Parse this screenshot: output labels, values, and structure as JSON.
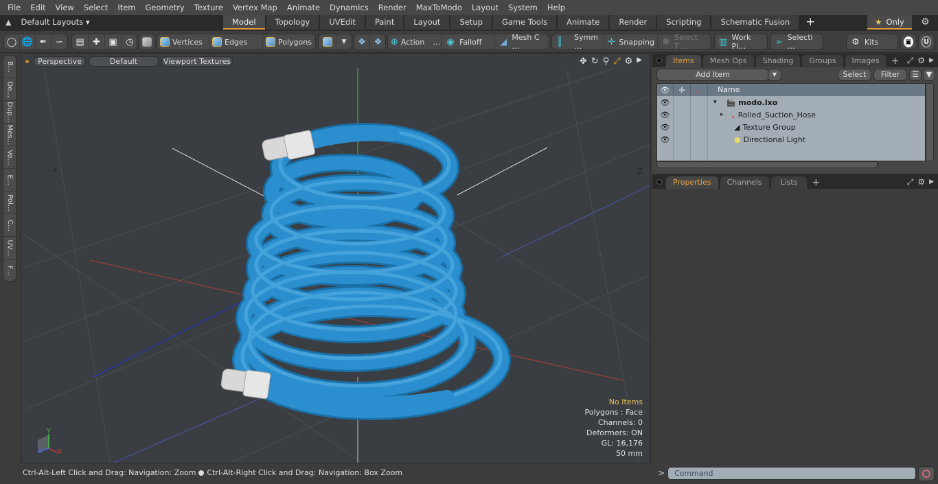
{
  "menu": [
    "File",
    "Edit",
    "View",
    "Select",
    "Item",
    "Geometry",
    "Texture",
    "Vertex Map",
    "Animate",
    "Dynamics",
    "Render",
    "MaxToModo",
    "Layout",
    "System",
    "Help"
  ],
  "layout_bar": {
    "layouts_label": "Default Layouts ▾",
    "tabs": [
      "Model",
      "Topology",
      "UVEdit",
      "Paint",
      "Layout",
      "Setup",
      "Game Tools",
      "Animate",
      "Render",
      "Scripting",
      "Schematic Fusion"
    ],
    "active_tab": "Model",
    "add_tab": "+",
    "only_label": "Only",
    "accent_color": "#e09a3c"
  },
  "toolbar": {
    "vertices": "Vertices",
    "edges": "Edges",
    "polygons": "Polygons",
    "action": "Action",
    "falloff": "Falloff",
    "mesh_c": "Mesh C …",
    "symm": "Symm …",
    "snapping": "Snapping",
    "select_t": "Select T…",
    "work_pl": "Work Pl…",
    "selecti": "Selecti …",
    "kits": "Kits",
    "ellipsis": "…"
  },
  "left_tabs": [
    "B…",
    "De…",
    "Dup…",
    "Mes…",
    "Ve…",
    "E…",
    "Pol…",
    "C…",
    "UV…",
    "F…"
  ],
  "viewport": {
    "view_mode": "Perspective",
    "shading": "Default",
    "textures": "Viewport Textures",
    "axis_labels": {
      "neg_x": "-X",
      "neg_z": "-Z",
      "x": "X",
      "y": "Y",
      "z": "Z"
    },
    "info": {
      "selection": "No Items",
      "polygons": "Polygons : Face",
      "channels": "Channels: 0",
      "deformers": "Deformers: ON",
      "gl": "GL: 16,176",
      "scale": "50 mm"
    },
    "hose_color": "#2b8fcf"
  },
  "items_panel": {
    "tabs": [
      "Items",
      "Mesh Ops",
      "Shading",
      "Groups",
      "Images"
    ],
    "active_tab": "Items",
    "add_item": "Add Item",
    "select": "Select",
    "filter": "Filter",
    "column_name": "Name",
    "tree": [
      {
        "name": "modo.lxo",
        "level": 0,
        "expander": "▾",
        "bold": true
      },
      {
        "name": "Rolled_Suction_Hose",
        "level": 1,
        "expander": "▸"
      },
      {
        "name": "Texture Group",
        "level": 1,
        "expander": ""
      },
      {
        "name": "Directional Light",
        "level": 1,
        "expander": ""
      }
    ]
  },
  "properties_panel": {
    "tabs": [
      "Properties",
      "Channels",
      "Lists"
    ],
    "active_tab": "Properties"
  },
  "status": {
    "hint_left": "Ctrl-Alt-Left Click and Drag: Navigation: Zoom",
    "hint_right": "Ctrl-Alt-Right Click and Drag: Navigation: Box Zoom"
  },
  "command": {
    "prompt": ">",
    "placeholder": "Command"
  }
}
